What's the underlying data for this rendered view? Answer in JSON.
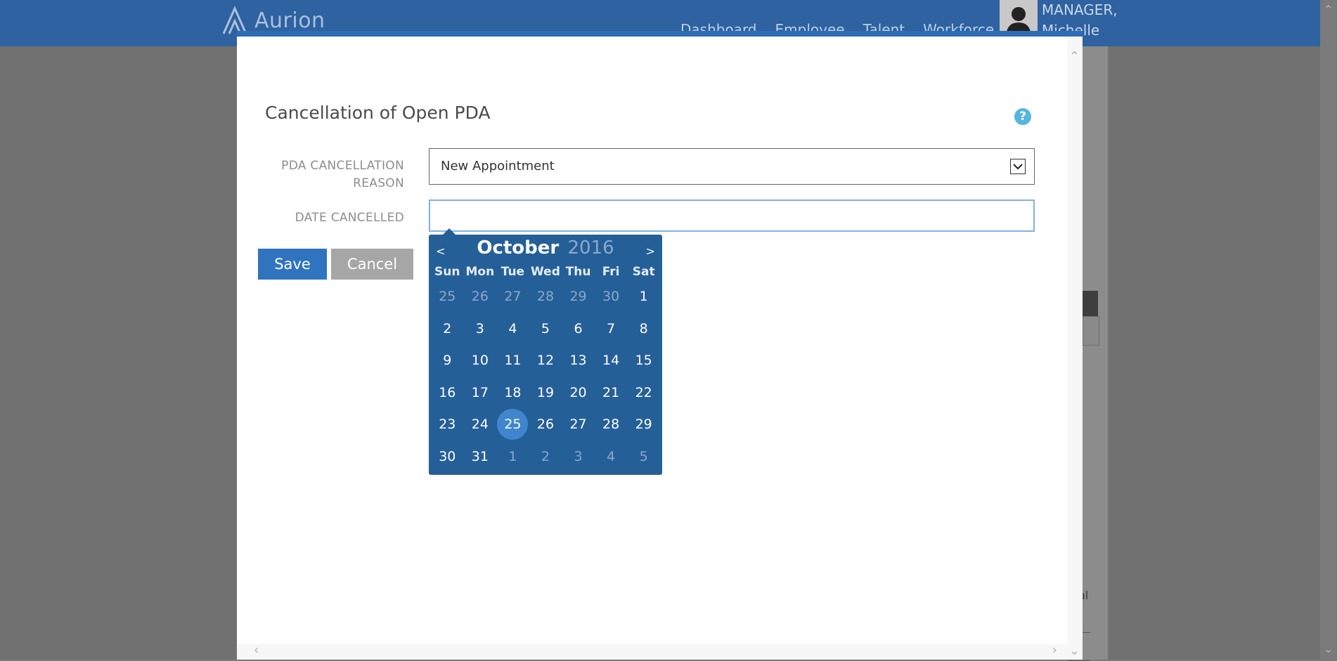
{
  "app": {
    "logo_text": "Aurion",
    "nav": [
      "Dashboard",
      "Employee",
      "Talent",
      "Workforce"
    ],
    "user_line1": "MANAGER,",
    "user_line2": "Michelle",
    "bg_fragment": "al"
  },
  "dialog": {
    "title": "Cancellation of Open PDA",
    "reason_label_line1": "PDA CANCELLATION",
    "reason_label_line2": "REASON",
    "reason_value": "New Appointment",
    "date_label": "DATE CANCELLED",
    "date_value": "",
    "save_label": "Save",
    "cancel_label": "Cancel"
  },
  "calendar": {
    "prev": "<",
    "next": ">",
    "month": "October",
    "year": "2016",
    "weekdays": [
      "Sun",
      "Mon",
      "Tue",
      "Wed",
      "Thu",
      "Fri",
      "Sat"
    ],
    "weeks": [
      [
        "25",
        "26",
        "27",
        "28",
        "29",
        "30",
        "1"
      ],
      [
        "2",
        "3",
        "4",
        "5",
        "6",
        "7",
        "8"
      ],
      [
        "9",
        "10",
        "11",
        "12",
        "13",
        "14",
        "15"
      ],
      [
        "16",
        "17",
        "18",
        "19",
        "20",
        "21",
        "22"
      ],
      [
        "23",
        "24",
        "25",
        "26",
        "27",
        "28",
        "29"
      ],
      [
        "30",
        "31",
        "1",
        "2",
        "3",
        "4",
        "5"
      ]
    ],
    "selected_day": "25",
    "accent": "#255f98",
    "highlight": "#3f86cf"
  }
}
